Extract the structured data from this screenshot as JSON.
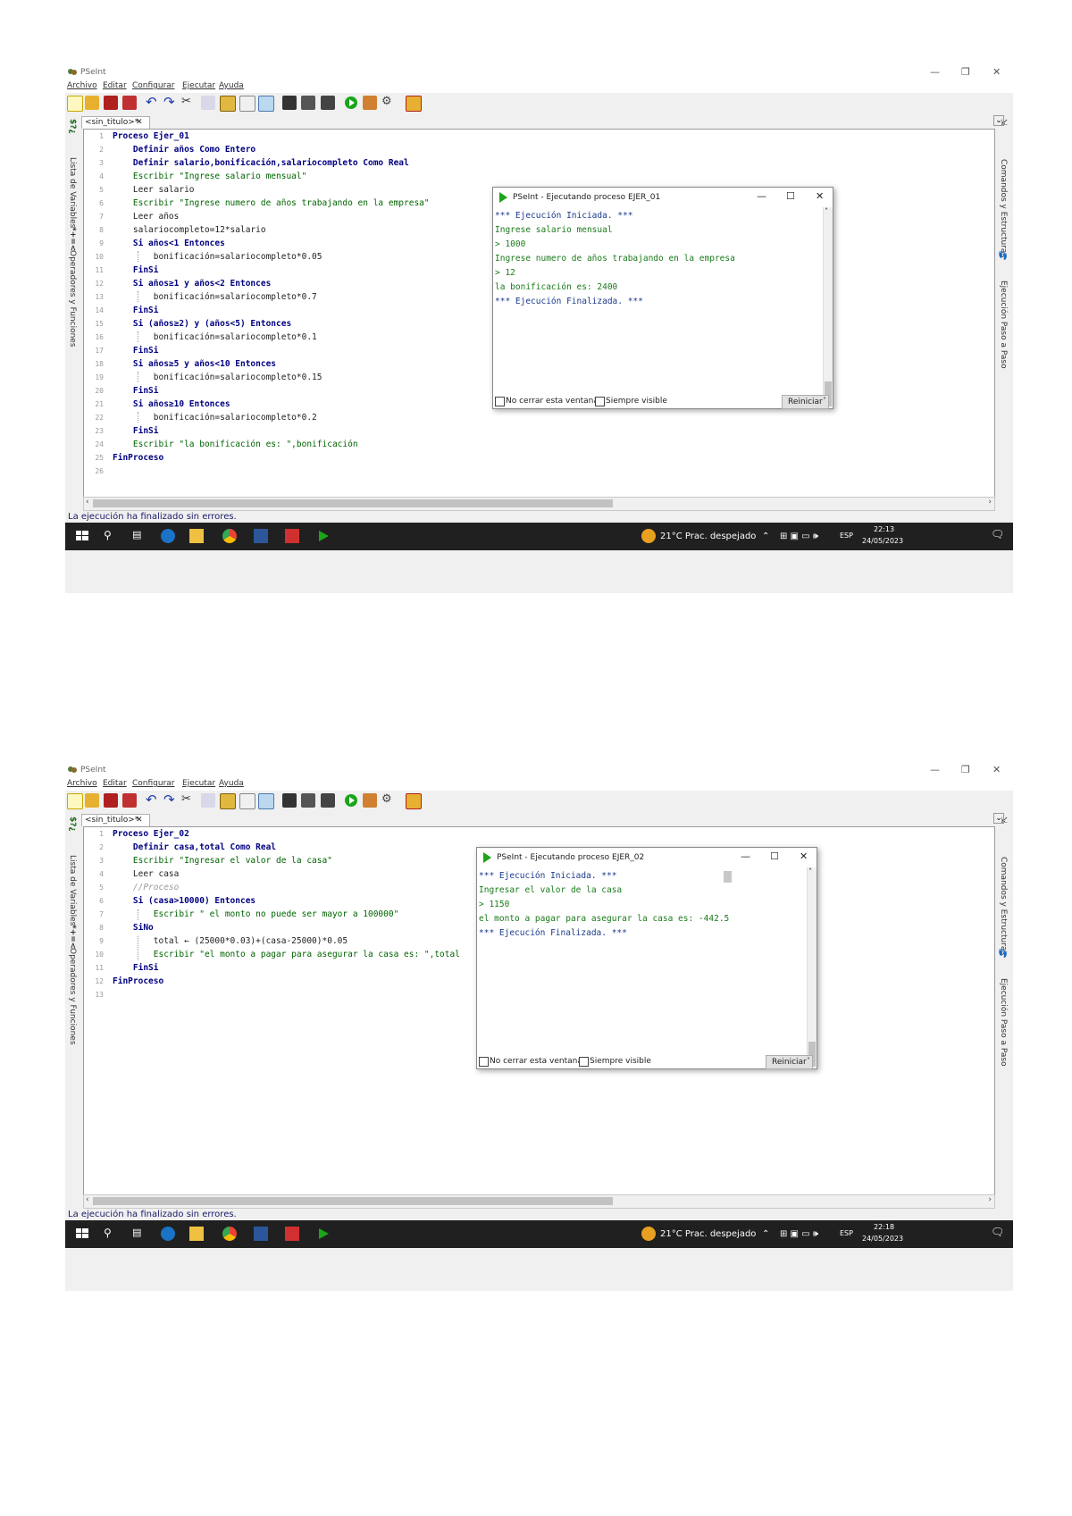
{
  "shots": [
    {
      "app_title": "PSeInt",
      "menu": [
        "Archivo",
        "Editar",
        "Configurar",
        "Ejecutar",
        "Ayuda"
      ],
      "tab_label": "<sin_titulo>*",
      "tab_close": "✕",
      "left_panel": {
        "variables": "Lista de Variables",
        "operators": "Operadores y Funciones"
      },
      "right_panel": {
        "commands": "Comandos y Estructuras",
        "step": "Ejecución Paso a Paso"
      },
      "line_numbers": [
        "1",
        "2",
        "3",
        "4",
        "5",
        "6",
        "7",
        "8",
        "9",
        "10",
        "11",
        "12",
        "13",
        "14",
        "15",
        "16",
        "17",
        "18",
        "19",
        "20",
        "21",
        "22",
        "23",
        "24",
        "25",
        "26"
      ],
      "code_lines": [
        "Proceso Ejer_01",
        "    Definir años Como Entero",
        "    Definir salario,bonificación,salariocompleto Como Real",
        "    Escribir \"Ingrese salario mensual\"",
        "    Leer salario",
        "    Escribir \"Ingrese numero de años trabajando en la empresa\"",
        "    Leer años",
        "    salariocompleto=12*salario",
        "    Si años<1 Entonces",
        "        bonificación=salariocompleto*0.05",
        "    FinSi",
        "    Si años≥1 y años<2 Entonces",
        "        bonificación=salariocompleto*0.7",
        "    FinSi",
        "    Si (años≥2) y (años<5) Entonces",
        "        bonificación=salariocompleto*0.1",
        "    FinSi",
        "    Si años≥5 y años<10 Entonces",
        "        bonificación=salariocompleto*0.15",
        "    FinSi",
        "    Si años≥10 Entonces",
        "        bonificación=salariocompleto*0.2",
        "    FinSi",
        "    Escribir \"la bonificación es: \",bonificación",
        "FinProceso",
        ""
      ],
      "status": "La ejecución ha finalizado sin errores.",
      "run_window": {
        "title": "PSeInt - Ejecutando proceso EJER_01",
        "output": [
          "*** Ejecución Iniciada. ***",
          "Ingrese salario mensual",
          "> 1000",
          "Ingrese numero de años trabajando en la empresa",
          "> 12",
          "la bonificación es: 2400",
          "*** Ejecución Finalizada. ***"
        ],
        "no_close": "No cerrar esta ventana",
        "always_visible": "Siempre visible",
        "restart": "Reiniciar"
      },
      "taskbar": {
        "weather": "21°C  Prac. despejado",
        "lang": "ESP",
        "time": "22:13",
        "date": "24/05/2023"
      }
    },
    {
      "app_title": "PSeInt",
      "menu": [
        "Archivo",
        "Editar",
        "Configurar",
        "Ejecutar",
        "Ayuda"
      ],
      "tab_label": "<sin_titulo>*",
      "tab_close": "✕",
      "left_panel": {
        "variables": "Lista de Variables",
        "operators": "Operadores y Funciones"
      },
      "right_panel": {
        "commands": "Comandos y Estructuras",
        "step": "Ejecución Paso a Paso"
      },
      "line_numbers": [
        "1",
        "2",
        "3",
        "4",
        "5",
        "6",
        "7",
        "8",
        "9",
        "10",
        "11",
        "12",
        "13"
      ],
      "code_lines": [
        "Proceso Ejer_02",
        "    Definir casa,total Como Real",
        "    Escribir \"Ingresar el valor de la casa\"",
        "    Leer casa",
        "    //Proceso",
        "    Si (casa>10000) Entonces",
        "        Escribir \" el monto no puede ser mayor a 100000\"",
        "    SiNo",
        "        total ← (25000*0.03)+(casa-25000)*0.05",
        "        Escribir \"el monto a pagar para asegurar la casa es: \",total",
        "    FinSi",
        "FinProceso",
        ""
      ],
      "status": "La ejecución ha finalizado sin errores.",
      "run_window": {
        "title": "PSeInt - Ejecutando proceso EJER_02",
        "output": [
          "*** Ejecución Iniciada. ***",
          "Ingresar el valor de la casa",
          "> 1150",
          "el monto a pagar para asegurar la casa es: -442.5",
          "*** Ejecución Finalizada. ***"
        ],
        "no_close": "No cerrar esta ventana",
        "always_visible": "Siempre visible",
        "restart": "Reiniciar"
      },
      "taskbar": {
        "weather": "21°C  Prac. despejado",
        "lang": "ESP",
        "time": "22:18",
        "date": "24/05/2023"
      }
    }
  ]
}
